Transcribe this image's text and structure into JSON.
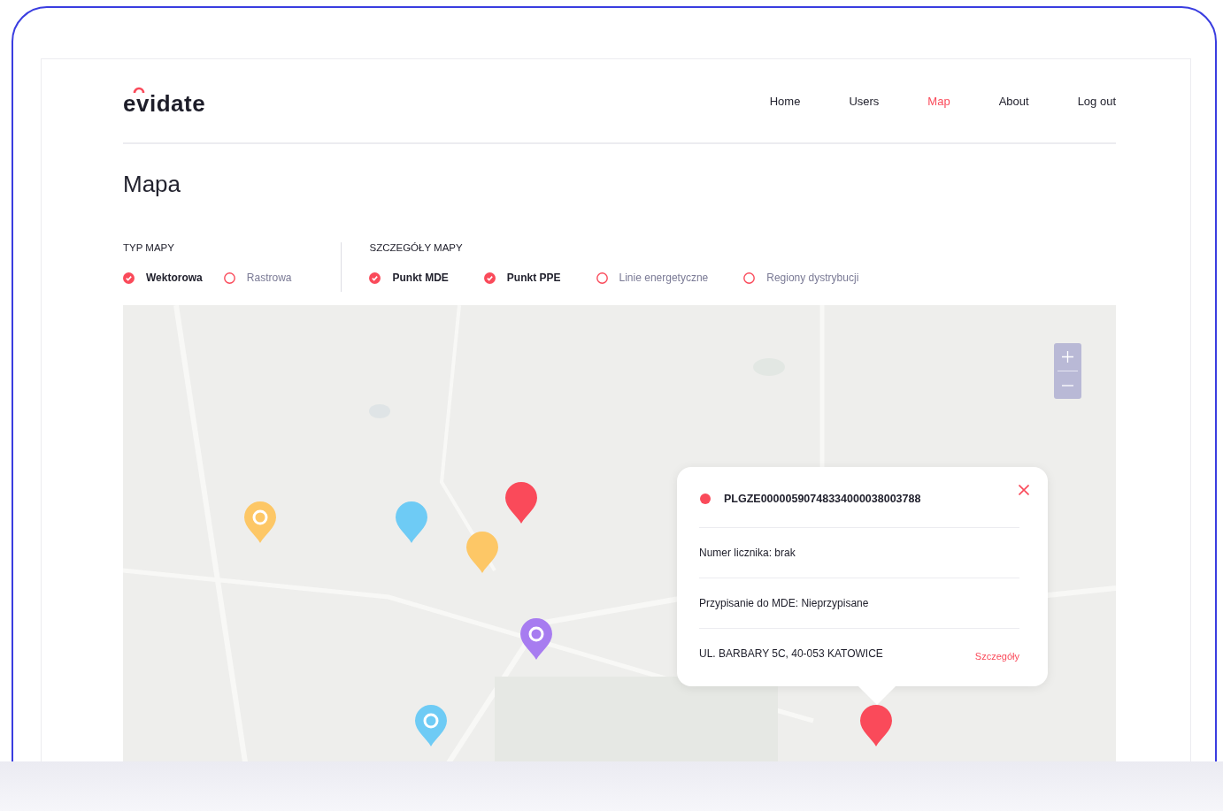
{
  "logo": "evidate",
  "nav": [
    {
      "label": "Home",
      "selected": false
    },
    {
      "label": "Users",
      "selected": false
    },
    {
      "label": "Map",
      "selected": true
    },
    {
      "label": "About",
      "selected": false
    },
    {
      "label": "Log out",
      "selected": false
    }
  ],
  "page_title": "Mapa",
  "map_type": {
    "label": "TYP MAPY",
    "options": [
      {
        "label": "Wektorowa",
        "selected": true
      },
      {
        "label": "Rastrowa",
        "selected": false
      }
    ]
  },
  "map_details": {
    "label": "SZCZEGÓŁY MAPY",
    "options": [
      {
        "label": "Punkt MDE",
        "checked": true
      },
      {
        "label": "Punkt PPE",
        "checked": true
      },
      {
        "label": "Linie energetyczne",
        "checked": false
      },
      {
        "label": "Regiony dystrybucji",
        "checked": false
      }
    ]
  },
  "pins": [
    {
      "kind": "ring",
      "color": "#fdc766"
    },
    {
      "kind": "plain",
      "color": "#6ecbf5"
    },
    {
      "kind": "plain",
      "color": "#fa4a5a"
    },
    {
      "kind": "plain",
      "color": "#fdc766"
    },
    {
      "kind": "ring",
      "color": "#a77cf0"
    },
    {
      "kind": "ring",
      "color": "#6ecbf5"
    },
    {
      "kind": "plain",
      "color": "#fa4a5a"
    }
  ],
  "popup": {
    "color": "#fa4a5a",
    "title": "PLGZE00000590748334000038003788",
    "rows": [
      "Numer licznika: brak",
      "Przypisanie do MDE: Nieprzypisane"
    ],
    "address": "UL. BARBARY 5C, 40-053 KATOWICE",
    "link": "Szczegóły"
  }
}
